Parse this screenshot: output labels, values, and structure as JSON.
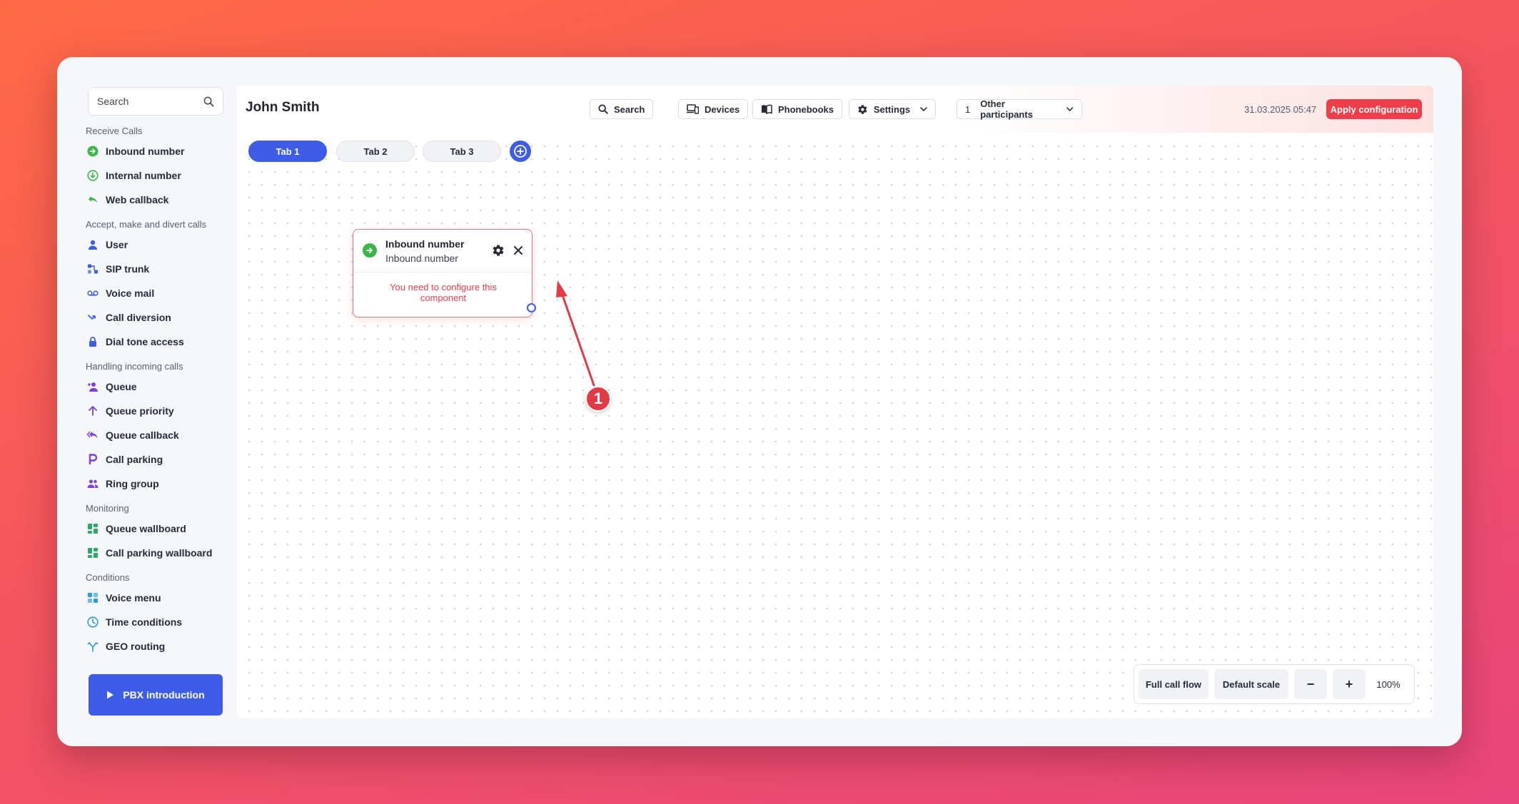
{
  "sidebar": {
    "search_placeholder": "Search",
    "sections": [
      {
        "title": "Receive Calls",
        "items": [
          {
            "label": "Inbound number",
            "icon": "inbound-number-icon"
          },
          {
            "label": "Internal number",
            "icon": "internal-number-icon"
          },
          {
            "label": "Web callback",
            "icon": "web-callback-icon"
          }
        ]
      },
      {
        "title": "Accept, make and divert calls",
        "items": [
          {
            "label": "User",
            "icon": "user-icon"
          },
          {
            "label": "SIP trunk",
            "icon": "sip-trunk-icon"
          },
          {
            "label": "Voice mail",
            "icon": "voicemail-icon"
          },
          {
            "label": "Call diversion",
            "icon": "call-diversion-icon"
          },
          {
            "label": "Dial tone access",
            "icon": "lock-icon"
          }
        ]
      },
      {
        "title": "Handling incoming calls",
        "items": [
          {
            "label": "Queue",
            "icon": "queue-icon"
          },
          {
            "label": "Queue priority",
            "icon": "arrow-up-icon"
          },
          {
            "label": "Queue callback",
            "icon": "queue-callback-icon"
          },
          {
            "label": "Call parking",
            "icon": "parking-icon"
          },
          {
            "label": "Ring group",
            "icon": "ring-group-icon"
          }
        ]
      },
      {
        "title": "Monitoring",
        "items": [
          {
            "label": "Queue wallboard",
            "icon": "dashboard-icon"
          },
          {
            "label": "Call parking wallboard",
            "icon": "dashboard-icon"
          }
        ]
      },
      {
        "title": "Conditions",
        "items": [
          {
            "label": "Voice menu",
            "icon": "voice-menu-icon"
          },
          {
            "label": "Time conditions",
            "icon": "clock-icon"
          },
          {
            "label": "GEO routing",
            "icon": "geo-routing-icon"
          }
        ]
      }
    ],
    "pbx_button": "PBX introduction"
  },
  "header": {
    "title": "John Smith",
    "search_label": "Search",
    "devices_label": "Devices",
    "phonebooks_label": "Phonebooks",
    "settings_label": "Settings",
    "participants_count": "1",
    "participants_label": "Other participants",
    "datetime": "31.03.2025 05:47",
    "apply_label": "Apply configuration"
  },
  "tabs": [
    {
      "label": "Tab 1",
      "active": true
    },
    {
      "label": "Tab 2",
      "active": false
    },
    {
      "label": "Tab 3",
      "active": false
    }
  ],
  "node": {
    "title": "Inbound number",
    "subtitle": "Inbound number",
    "message": "You need to configure this component"
  },
  "annotation": {
    "number": "1"
  },
  "zoom": {
    "full_flow_label": "Full call flow",
    "default_scale_label": "Default scale",
    "minus_label": "−",
    "plus_label": "+",
    "value": "100%"
  },
  "colors": {
    "accent": "#3d5ce8",
    "danger": "#ef3e4a",
    "green": "#3cb54a",
    "purple": "#7b3fe4"
  }
}
